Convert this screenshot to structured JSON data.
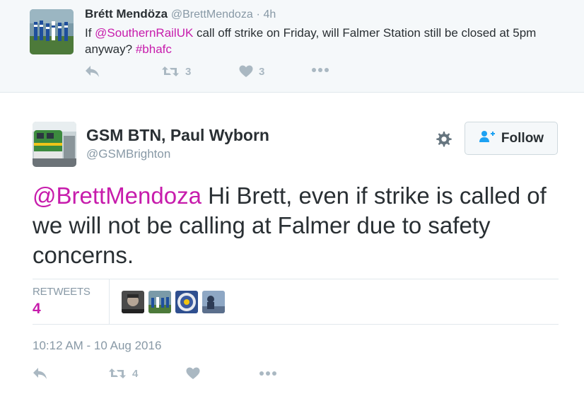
{
  "parent_tweet": {
    "name": "Brétt Mendöza",
    "handle": "@BrettMendoza",
    "separator": "·",
    "time": "4h",
    "text_parts": [
      "If ",
      "@SouthernRailUK",
      " call off strike on Friday, will Falmer Station still be closed at 5pm anyway? ",
      "#bhafc"
    ],
    "retweet_count": "3",
    "like_count": "3"
  },
  "main_tweet": {
    "name": "GSM BTN, Paul Wyborn",
    "handle": "@GSMBrighton",
    "follow_label": "Follow",
    "text_mention": "@BrettMendoza",
    "text_body": " Hi Brett, even if strike is called of we will not be calling at Falmer due to safety concerns.",
    "retweets_label": "RETWEETS",
    "retweets_count": "4",
    "timestamp": "10:12 AM - 10 Aug 2016",
    "retweet_count": "4"
  },
  "colors": {
    "link": "#c71cac",
    "action_icon": "#aab8c2",
    "follow_icon": "#1da1f2",
    "background_parent": "#f5f8fa"
  },
  "icons": [
    "reply-icon",
    "retweet-icon",
    "heart-icon",
    "more-icon",
    "gear-icon",
    "follow-user-icon"
  ]
}
